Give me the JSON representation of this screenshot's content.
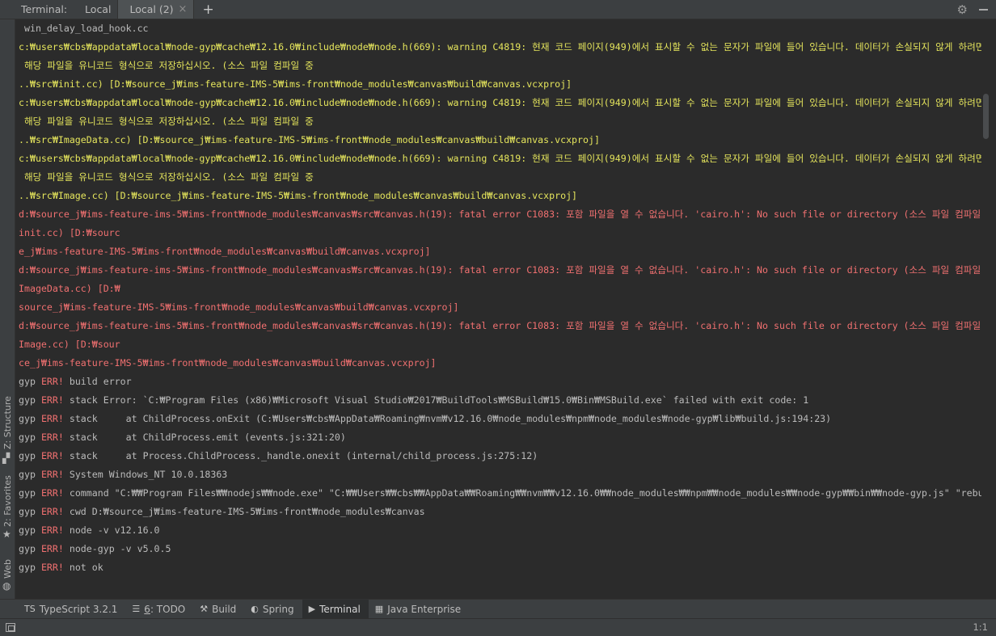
{
  "topbar": {
    "label": "Terminal:",
    "tabs": [
      {
        "label": "Local"
      },
      {
        "label": "Local (2)"
      }
    ],
    "add_tab": "+",
    "close_glyph": "×"
  },
  "left_tools": {
    "structure": "Z: Structure",
    "favorites": "2: Favorites",
    "web": "Web"
  },
  "terminal": {
    "lines": [
      {
        "type": "normal",
        "text": " win_delay_load_hook.cc"
      },
      {
        "type": "warn",
        "text": "c:₩users₩cbs₩appdata₩local₩node-gyp₩cache₩12.16.0₩include₩node₩node.h(669): warning C4819: 현재 코드 페이지(949)에서 표시할 수 없는 문자가 파일에 들어 있습니다. 데이터가 손실되지 않게 하려면"
      },
      {
        "type": "warn",
        "text": " 해당 파일을 유니코드 형식으로 저장하십시오. (소스 파일 컴파일 중"
      },
      {
        "type": "warn",
        "text": "..₩src₩init.cc) [D:₩source_j₩ims-feature-IMS-5₩ims-front₩node_modules₩canvas₩build₩canvas.vcxproj]"
      },
      {
        "type": "warn",
        "text": "c:₩users₩cbs₩appdata₩local₩node-gyp₩cache₩12.16.0₩include₩node₩node.h(669): warning C4819: 현재 코드 페이지(949)에서 표시할 수 없는 문자가 파일에 들어 있습니다. 데이터가 손실되지 않게 하려면"
      },
      {
        "type": "warn",
        "text": " 해당 파일을 유니코드 형식으로 저장하십시오. (소스 파일 컴파일 중"
      },
      {
        "type": "warn",
        "text": "..₩src₩ImageData.cc) [D:₩source_j₩ims-feature-IMS-5₩ims-front₩node_modules₩canvas₩build₩canvas.vcxproj]"
      },
      {
        "type": "warn",
        "text": "c:₩users₩cbs₩appdata₩local₩node-gyp₩cache₩12.16.0₩include₩node₩node.h(669): warning C4819: 현재 코드 페이지(949)에서 표시할 수 없는 문자가 파일에 들어 있습니다. 데이터가 손실되지 않게 하려면"
      },
      {
        "type": "warn",
        "text": " 해당 파일을 유니코드 형식으로 저장하십시오. (소스 파일 컴파일 중"
      },
      {
        "type": "warn",
        "text": "..₩src₩Image.cc) [D:₩source_j₩ims-feature-IMS-5₩ims-front₩node_modules₩canvas₩build₩canvas.vcxproj]"
      },
      {
        "type": "error",
        "text": "d:₩source_j₩ims-feature-ims-5₩ims-front₩node_modules₩canvas₩src₩canvas.h(19): fatal error C1083: 포함 파일을 열 수 없습니다. 'cairo.h': No such file or directory (소스 파일 컴파일 중 ..₩src₩"
      },
      {
        "type": "error",
        "text": "init.cc) [D:₩sourc"
      },
      {
        "type": "error",
        "text": "e_j₩ims-feature-IMS-5₩ims-front₩node_modules₩canvas₩build₩canvas.vcxproj]"
      },
      {
        "type": "error",
        "text": "d:₩source_j₩ims-feature-ims-5₩ims-front₩node_modules₩canvas₩src₩canvas.h(19): fatal error C1083: 포함 파일을 열 수 없습니다. 'cairo.h': No such file or directory (소스 파일 컴파일 중 ..₩src₩"
      },
      {
        "type": "error",
        "text": "ImageData.cc) [D:₩"
      },
      {
        "type": "error",
        "text": "source_j₩ims-feature-IMS-5₩ims-front₩node_modules₩canvas₩build₩canvas.vcxproj]"
      },
      {
        "type": "error",
        "text": "d:₩source_j₩ims-feature-ims-5₩ims-front₩node_modules₩canvas₩src₩canvas.h(19): fatal error C1083: 포함 파일을 열 수 없습니다. 'cairo.h': No such file or directory (소스 파일 컴파일 중 ..₩src₩"
      },
      {
        "type": "error",
        "text": "Image.cc) [D:₩sour"
      },
      {
        "type": "error",
        "text": "ce_j₩ims-feature-IMS-5₩ims-front₩node_modules₩canvas₩build₩canvas.vcxproj]"
      },
      {
        "type": "gyp",
        "prefix": "gyp",
        "err": "ERR!",
        "text": " build error"
      },
      {
        "type": "gyp",
        "prefix": "gyp",
        "err": "ERR!",
        "text": " stack Error: `C:₩Program Files (x86)₩Microsoft Visual Studio₩2017₩BuildTools₩MSBuild₩15.0₩Bin₩MSBuild.exe` failed with exit code: 1"
      },
      {
        "type": "gyp",
        "prefix": "gyp",
        "err": "ERR!",
        "text": " stack     at ChildProcess.onExit (C:₩Users₩cbs₩AppData₩Roaming₩nvm₩v12.16.0₩node_modules₩npm₩node_modules₩node-gyp₩lib₩build.js:194:23)"
      },
      {
        "type": "gyp",
        "prefix": "gyp",
        "err": "ERR!",
        "text": " stack     at ChildProcess.emit (events.js:321:20)"
      },
      {
        "type": "gyp",
        "prefix": "gyp",
        "err": "ERR!",
        "text": " stack     at Process.ChildProcess._handle.onexit (internal/child_process.js:275:12)"
      },
      {
        "type": "gyp",
        "prefix": "gyp",
        "err": "ERR!",
        "text": " System Windows_NT 10.0.18363"
      },
      {
        "type": "gyp",
        "prefix": "gyp",
        "err": "ERR!",
        "text": " command \"C:₩₩Program Files₩₩nodejs₩₩node.exe\" \"C:₩₩Users₩₩cbs₩₩AppData₩₩Roaming₩₩nvm₩₩v12.16.0₩₩node_modules₩₩npm₩₩node_modules₩₩node-gyp₩₩bin₩₩node-gyp.js\" \"rebuild\""
      },
      {
        "type": "gyp",
        "prefix": "gyp",
        "err": "ERR!",
        "text": " cwd D:₩source_j₩ims-feature-IMS-5₩ims-front₩node_modules₩canvas"
      },
      {
        "type": "gyp",
        "prefix": "gyp",
        "err": "ERR!",
        "text": " node -v v12.16.0"
      },
      {
        "type": "gyp",
        "prefix": "gyp",
        "err": "ERR!",
        "text": " node-gyp -v v5.0.5"
      },
      {
        "type": "gyp",
        "prefix": "gyp",
        "err": "ERR!",
        "text": " not ok"
      }
    ]
  },
  "bottom_tabs": [
    {
      "icon": "TS",
      "label": "TypeScript 3.2.1"
    },
    {
      "icon": "☰",
      "num": "6",
      "label": ": TODO"
    },
    {
      "icon": "⚒",
      "label": "Build"
    },
    {
      "icon": "◐",
      "label": "Spring"
    },
    {
      "icon": "▶",
      "label": "Terminal"
    },
    {
      "icon": "▦",
      "label": "Java Enterprise"
    }
  ],
  "status": {
    "position": "1:1"
  },
  "colors": {
    "warn": "#e5e55c",
    "error": "#f07070",
    "normal": "#bbbbbb"
  }
}
